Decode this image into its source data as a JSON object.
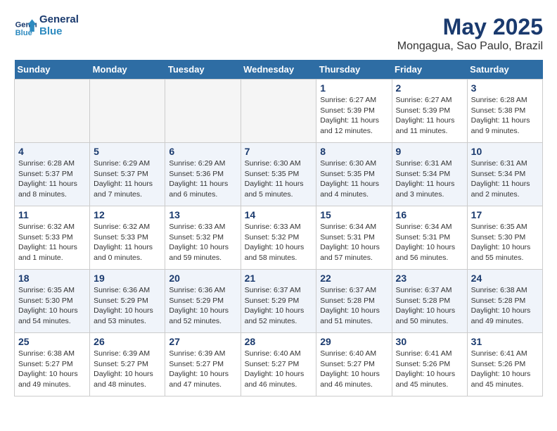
{
  "header": {
    "logo_line1": "General",
    "logo_line2": "Blue",
    "month": "May 2025",
    "location": "Mongagua, Sao Paulo, Brazil"
  },
  "days_of_week": [
    "Sunday",
    "Monday",
    "Tuesday",
    "Wednesday",
    "Thursday",
    "Friday",
    "Saturday"
  ],
  "weeks": [
    [
      {
        "num": "",
        "info": ""
      },
      {
        "num": "",
        "info": ""
      },
      {
        "num": "",
        "info": ""
      },
      {
        "num": "",
        "info": ""
      },
      {
        "num": "1",
        "info": "Sunrise: 6:27 AM\nSunset: 5:39 PM\nDaylight: 11 hours and 12 minutes."
      },
      {
        "num": "2",
        "info": "Sunrise: 6:27 AM\nSunset: 5:39 PM\nDaylight: 11 hours and 11 minutes."
      },
      {
        "num": "3",
        "info": "Sunrise: 6:28 AM\nSunset: 5:38 PM\nDaylight: 11 hours and 9 minutes."
      }
    ],
    [
      {
        "num": "4",
        "info": "Sunrise: 6:28 AM\nSunset: 5:37 PM\nDaylight: 11 hours and 8 minutes."
      },
      {
        "num": "5",
        "info": "Sunrise: 6:29 AM\nSunset: 5:37 PM\nDaylight: 11 hours and 7 minutes."
      },
      {
        "num": "6",
        "info": "Sunrise: 6:29 AM\nSunset: 5:36 PM\nDaylight: 11 hours and 6 minutes."
      },
      {
        "num": "7",
        "info": "Sunrise: 6:30 AM\nSunset: 5:35 PM\nDaylight: 11 hours and 5 minutes."
      },
      {
        "num": "8",
        "info": "Sunrise: 6:30 AM\nSunset: 5:35 PM\nDaylight: 11 hours and 4 minutes."
      },
      {
        "num": "9",
        "info": "Sunrise: 6:31 AM\nSunset: 5:34 PM\nDaylight: 11 hours and 3 minutes."
      },
      {
        "num": "10",
        "info": "Sunrise: 6:31 AM\nSunset: 5:34 PM\nDaylight: 11 hours and 2 minutes."
      }
    ],
    [
      {
        "num": "11",
        "info": "Sunrise: 6:32 AM\nSunset: 5:33 PM\nDaylight: 11 hours and 1 minute."
      },
      {
        "num": "12",
        "info": "Sunrise: 6:32 AM\nSunset: 5:33 PM\nDaylight: 11 hours and 0 minutes."
      },
      {
        "num": "13",
        "info": "Sunrise: 6:33 AM\nSunset: 5:32 PM\nDaylight: 10 hours and 59 minutes."
      },
      {
        "num": "14",
        "info": "Sunrise: 6:33 AM\nSunset: 5:32 PM\nDaylight: 10 hours and 58 minutes."
      },
      {
        "num": "15",
        "info": "Sunrise: 6:34 AM\nSunset: 5:31 PM\nDaylight: 10 hours and 57 minutes."
      },
      {
        "num": "16",
        "info": "Sunrise: 6:34 AM\nSunset: 5:31 PM\nDaylight: 10 hours and 56 minutes."
      },
      {
        "num": "17",
        "info": "Sunrise: 6:35 AM\nSunset: 5:30 PM\nDaylight: 10 hours and 55 minutes."
      }
    ],
    [
      {
        "num": "18",
        "info": "Sunrise: 6:35 AM\nSunset: 5:30 PM\nDaylight: 10 hours and 54 minutes."
      },
      {
        "num": "19",
        "info": "Sunrise: 6:36 AM\nSunset: 5:29 PM\nDaylight: 10 hours and 53 minutes."
      },
      {
        "num": "20",
        "info": "Sunrise: 6:36 AM\nSunset: 5:29 PM\nDaylight: 10 hours and 52 minutes."
      },
      {
        "num": "21",
        "info": "Sunrise: 6:37 AM\nSunset: 5:29 PM\nDaylight: 10 hours and 52 minutes."
      },
      {
        "num": "22",
        "info": "Sunrise: 6:37 AM\nSunset: 5:28 PM\nDaylight: 10 hours and 51 minutes."
      },
      {
        "num": "23",
        "info": "Sunrise: 6:37 AM\nSunset: 5:28 PM\nDaylight: 10 hours and 50 minutes."
      },
      {
        "num": "24",
        "info": "Sunrise: 6:38 AM\nSunset: 5:28 PM\nDaylight: 10 hours and 49 minutes."
      }
    ],
    [
      {
        "num": "25",
        "info": "Sunrise: 6:38 AM\nSunset: 5:27 PM\nDaylight: 10 hours and 49 minutes."
      },
      {
        "num": "26",
        "info": "Sunrise: 6:39 AM\nSunset: 5:27 PM\nDaylight: 10 hours and 48 minutes."
      },
      {
        "num": "27",
        "info": "Sunrise: 6:39 AM\nSunset: 5:27 PM\nDaylight: 10 hours and 47 minutes."
      },
      {
        "num": "28",
        "info": "Sunrise: 6:40 AM\nSunset: 5:27 PM\nDaylight: 10 hours and 46 minutes."
      },
      {
        "num": "29",
        "info": "Sunrise: 6:40 AM\nSunset: 5:27 PM\nDaylight: 10 hours and 46 minutes."
      },
      {
        "num": "30",
        "info": "Sunrise: 6:41 AM\nSunset: 5:26 PM\nDaylight: 10 hours and 45 minutes."
      },
      {
        "num": "31",
        "info": "Sunrise: 6:41 AM\nSunset: 5:26 PM\nDaylight: 10 hours and 45 minutes."
      }
    ]
  ]
}
